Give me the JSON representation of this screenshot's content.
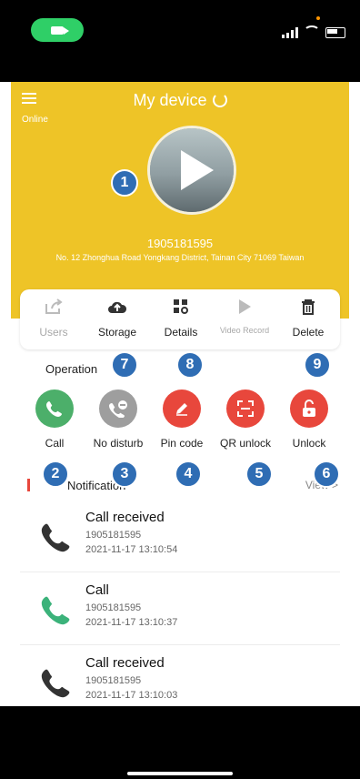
{
  "header": {
    "title": "My device",
    "status": "Online",
    "device_id": "1905181595",
    "address": "No. 12 Zhonghua Road Yongkang District, Tainan City 71069 Taiwan"
  },
  "toolbar": {
    "items": [
      {
        "label": "Users",
        "icon": "share-icon",
        "enabled": false
      },
      {
        "label": "Storage",
        "icon": "cloud-upload-icon",
        "enabled": true
      },
      {
        "label": "Details",
        "icon": "grid-search-icon",
        "enabled": true
      },
      {
        "label": "Video Record",
        "icon": "play-icon",
        "enabled": false
      },
      {
        "label": "Delete",
        "icon": "trash-icon",
        "enabled": true
      }
    ]
  },
  "operation": {
    "heading": "Operation",
    "items": [
      {
        "label": "Call",
        "icon": "phone-icon",
        "color": "#4caf6a"
      },
      {
        "label": "No disturb",
        "icon": "no-disturb-icon",
        "color": "#9e9e9e"
      },
      {
        "label": "Pin code",
        "icon": "pencil-icon",
        "color": "#e8473c"
      },
      {
        "label": "QR unlock",
        "icon": "qr-scan-icon",
        "color": "#e8473c"
      },
      {
        "label": "Unlock",
        "icon": "unlock-icon",
        "color": "#e8473c"
      }
    ]
  },
  "markers": [
    "1",
    "2",
    "3",
    "4",
    "5",
    "6",
    "7",
    "8",
    "9"
  ],
  "notifications": {
    "heading": "Notification",
    "view_all": "View >",
    "items": [
      {
        "title": "Call received",
        "id": "1905181595",
        "time": "2021-11-17 13:10:54",
        "icon_color": "#333333"
      },
      {
        "title": "Call",
        "id": "1905181595",
        "time": "2021-11-17 13:10:37",
        "icon_color": "#3bb27a"
      },
      {
        "title": "Call received",
        "id": "1905181595",
        "time": "2021-11-17 13:10:03",
        "icon_color": "#333333"
      }
    ]
  },
  "colors": {
    "header_bg": "#eec427",
    "accent_green": "#2fcf67",
    "marker_blue": "#2f6db4"
  }
}
